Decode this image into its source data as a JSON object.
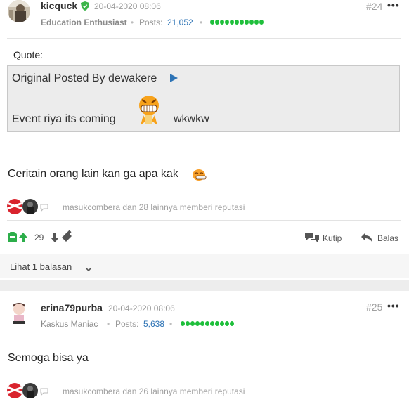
{
  "post1": {
    "username": "kicquck",
    "date": "20-04-2020 08:06",
    "title": "Education Enthusiast",
    "posts_label": "Posts:",
    "posts_count": "21,052",
    "post_number": "#24",
    "more": "•••",
    "quote_label": "Quote:",
    "quote_header": "Original Posted By dewakere",
    "quote_text": "Event riya its coming",
    "quote_text_suffix": "wkwkw",
    "body": "Ceritain orang lain kan ga apa kak",
    "reputation_text": "masukcombera dan 28 lainnya memberi reputasi",
    "vote_count": "29",
    "quote_action": "Kutip",
    "reply_action": "Balas",
    "see_replies": "Lihat 1 balasan"
  },
  "post2": {
    "username": "erina79purba",
    "date": "20-04-2020 08:06",
    "title": "Kaskus Maniac",
    "posts_label": "Posts:",
    "posts_count": "5,638",
    "post_number": "#25",
    "more": "•••",
    "body": "Semoga bisa ya",
    "reputation_text": "masukcombera dan 26 lainnya memberi reputasi"
  },
  "colors": {
    "accent_blue": "#2d73b5",
    "rep_green": "#1fbf3b",
    "upvote_green": "#2cae4a"
  }
}
